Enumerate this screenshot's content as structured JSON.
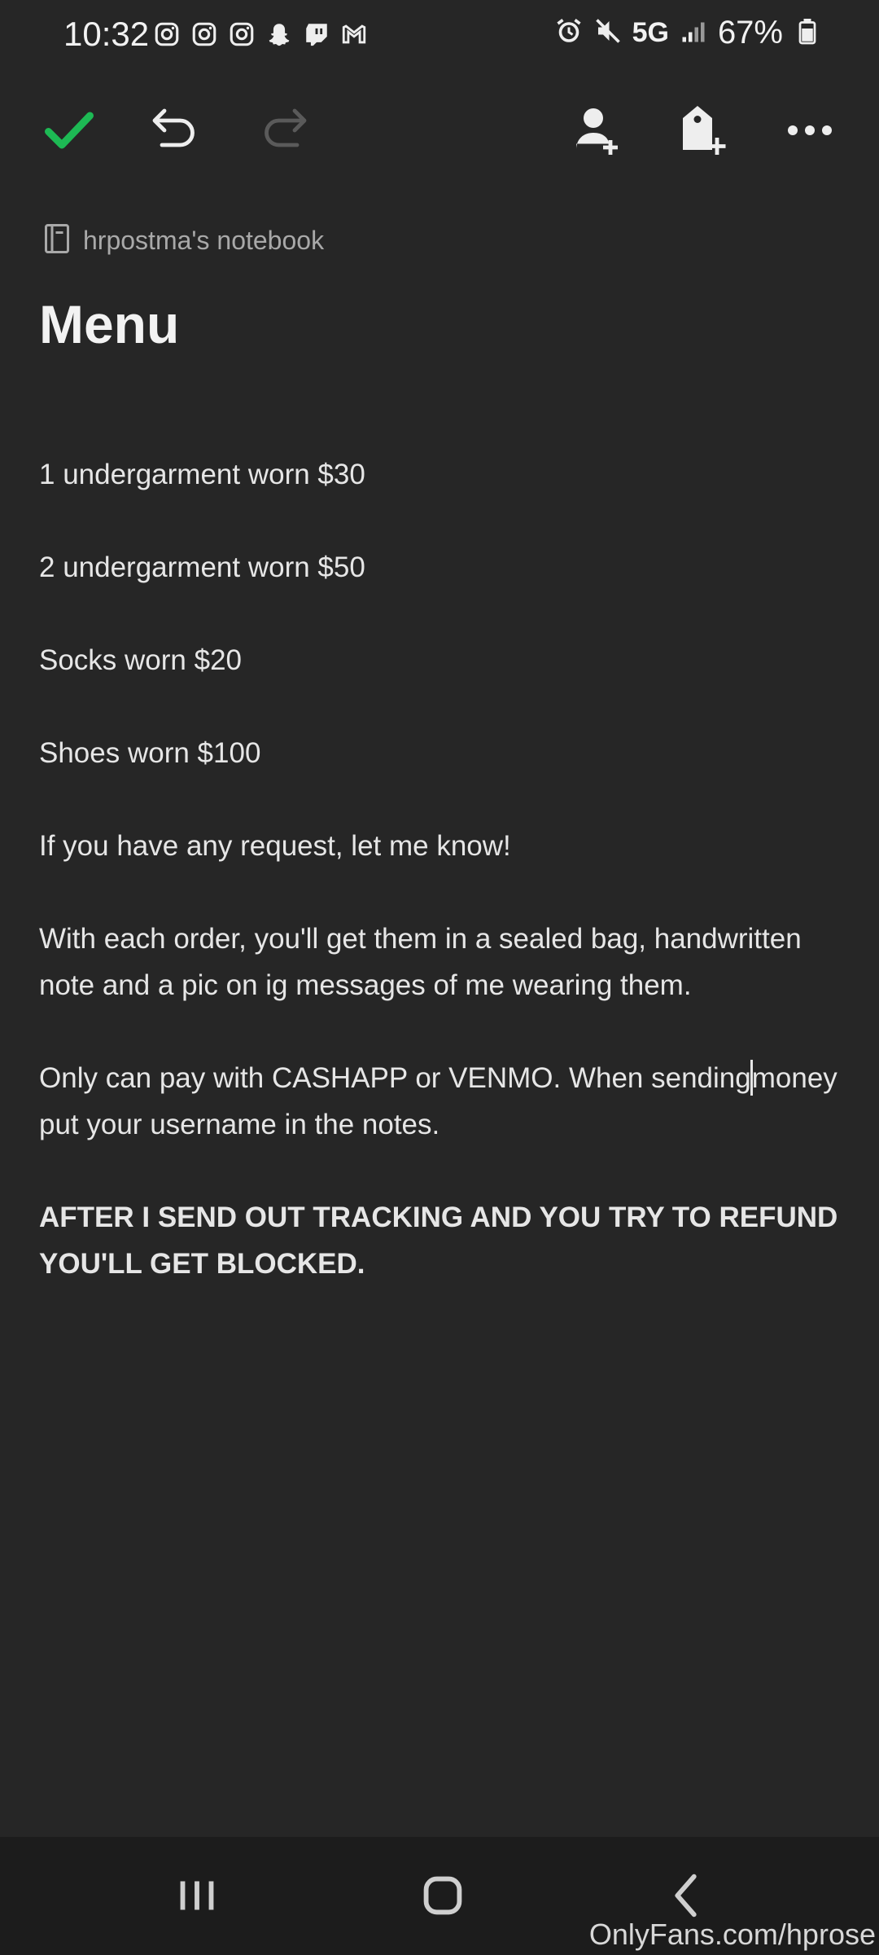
{
  "status_bar": {
    "time": "10:32",
    "left_icons": [
      "instagram-icon",
      "instagram-icon",
      "instagram-icon",
      "snapchat-icon",
      "twitch-icon",
      "gmail-icon"
    ],
    "right_icons": [
      "alarm-icon",
      "mute-icon",
      "signal-icon",
      "battery-icon"
    ],
    "network": "5G",
    "battery": "67%"
  },
  "toolbar": {
    "done_icon": "checkmark-icon",
    "undo_icon": "undo-icon",
    "redo_icon": "redo-icon",
    "share_icon": "add-person-icon",
    "tag_icon": "add-tag-icon",
    "more_icon": "more-icon",
    "accent_color": "#1db954"
  },
  "note": {
    "notebook": "hrpostma's notebook",
    "title": "Menu",
    "lines": [
      "1 undergarment worn $30",
      "2 undergarment worn $50",
      "Socks worn $20",
      "Shoes worn $100",
      "If you have any request, let me know!",
      "With each order, you'll get them in a sealed bag, handwritten note and a pic on ig messages of me wearing them.",
      "Only can pay with CASHAPP or VENMO. When sending",
      "money put your username in the notes."
    ],
    "warning": "AFTER I SEND OUT TRACKING AND YOU TRY TO REFUND YOU'LL GET BLOCKED."
  },
  "nav_bar": {
    "recents_icon": "recents-icon",
    "home_icon": "home-icon",
    "back_icon": "back-icon"
  },
  "watermark": "OnlyFans.com/hprose"
}
